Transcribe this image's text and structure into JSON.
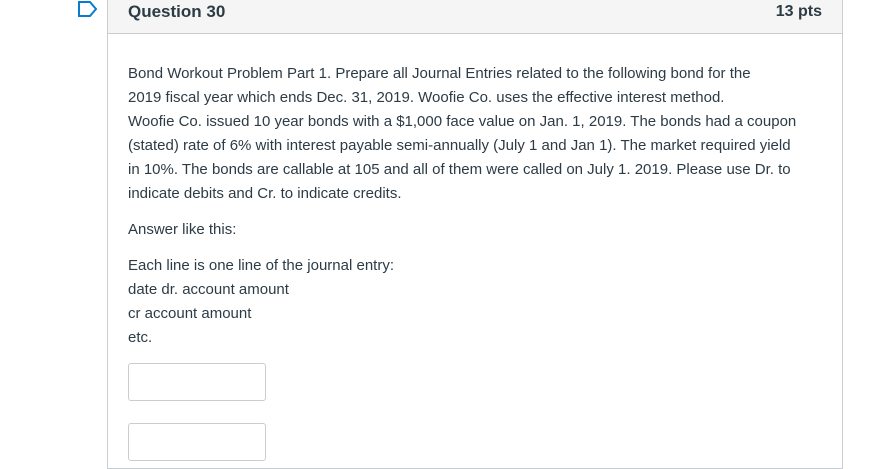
{
  "question": {
    "title": "Question 30",
    "points": "13 pts",
    "paragraph1_lines": [
      "Bond Workout Problem Part 1. Prepare all Journal Entries related to the following bond for the",
      "2019 fiscal year which ends Dec. 31, 2019. Woofie Co. uses the effective interest method.",
      "Woofie Co. issued 10 year bonds with a $1,000 face value on Jan. 1, 2019. The bonds had a coupon",
      "(stated) rate of 6% with interest payable semi-annually (July 1 and Jan 1). The market required yield",
      "in 10%. The bonds are callable at 105 and all of them were called on July 1. 2019. Please use Dr. to",
      "indicate debits and Cr. to indicate credits."
    ],
    "answer_intro": "Answer like this:",
    "format_lines": [
      "Each line is one line of the journal entry:",
      "date dr. account amount",
      "cr account amount",
      "etc."
    ],
    "answer_fields": [
      {
        "value": "",
        "placeholder": ""
      },
      {
        "value": "",
        "placeholder": ""
      }
    ]
  },
  "colors": {
    "text": "#2d3b45",
    "border": "#c7cdd1",
    "header_bg": "#f5f5f5",
    "flag_outline": "#0b7ccb"
  }
}
